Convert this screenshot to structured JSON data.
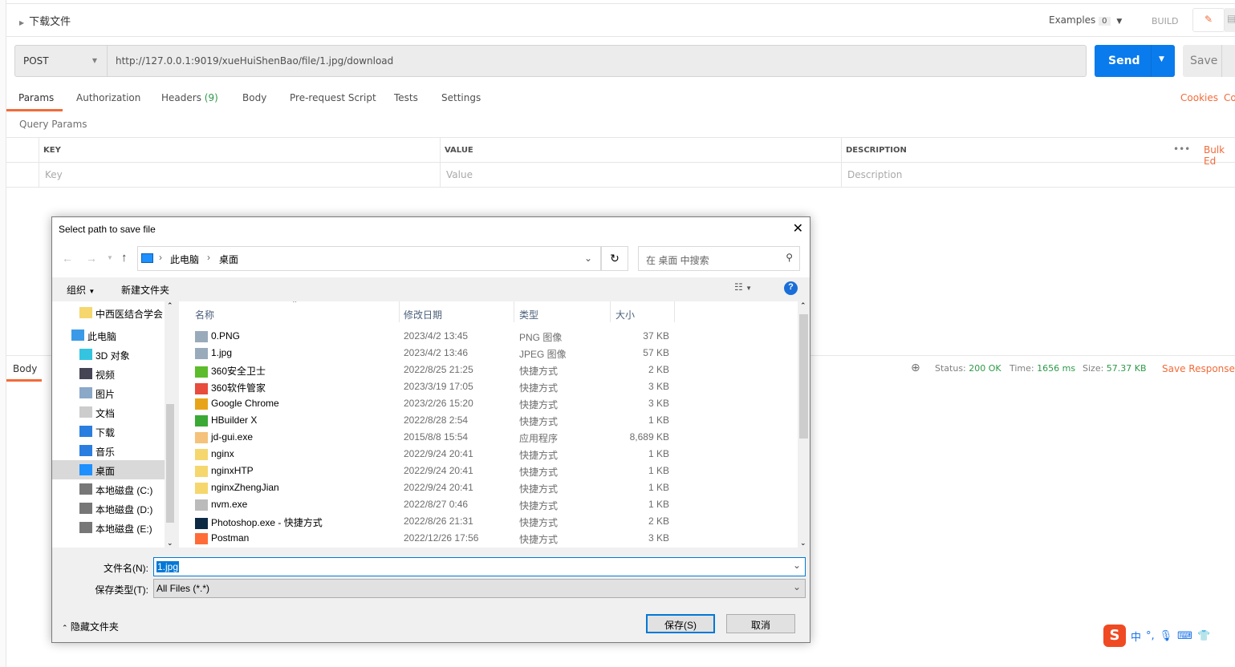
{
  "request": {
    "name": "下载文件",
    "examples_label": "Examples",
    "examples_count": "0",
    "build_label": "BUILD",
    "method": "POST",
    "url": "http://127.0.0.1:9019/xueHuiShenBao/file/1.jpg/download",
    "send_label": "Send",
    "save_label": "Save"
  },
  "tabs": [
    {
      "label": "Params",
      "active": true
    },
    {
      "label": "Authorization"
    },
    {
      "label": "Headers",
      "count": "(9)"
    },
    {
      "label": "Body"
    },
    {
      "label": "Pre-request Script"
    },
    {
      "label": "Tests"
    },
    {
      "label": "Settings"
    }
  ],
  "links": {
    "cookies": "Cookies",
    "code": "Co",
    "bulk_edit": "Bulk Ed"
  },
  "params": {
    "title": "Query Params",
    "headers": [
      "KEY",
      "VALUE",
      "DESCRIPTION"
    ],
    "placeholders": [
      "Key",
      "Value",
      "Description"
    ],
    "more": "•••"
  },
  "response": {
    "body_tab": "Body",
    "status_label": "Status:",
    "status": "200 OK",
    "time_label": "Time:",
    "time": "1656 ms",
    "size_label": "Size:",
    "size": "57.37 KB",
    "save_response": "Save Response"
  },
  "dialog": {
    "title": "Select path to save file",
    "breadcrumb": [
      "此电脑",
      "桌面"
    ],
    "search_placeholder": "在 桌面 中搜索",
    "organize": "组织",
    "new_folder": "新建文件夹",
    "nav": [
      {
        "label": "中西医结合学会",
        "icon": "folder-icon"
      },
      {
        "label": "此电脑",
        "icon": "computer-icon"
      },
      {
        "label": "3D 对象",
        "icon": "cube-icon"
      },
      {
        "label": "视频",
        "icon": "video-icon"
      },
      {
        "label": "图片",
        "icon": "picture-icon"
      },
      {
        "label": "文档",
        "icon": "document-icon"
      },
      {
        "label": "下载",
        "icon": "download-icon"
      },
      {
        "label": "音乐",
        "icon": "music-icon"
      },
      {
        "label": "桌面",
        "icon": "desktop-icon",
        "selected": true
      },
      {
        "label": "本地磁盘 (C:)",
        "icon": "drive-icon"
      },
      {
        "label": "本地磁盘 (D:)",
        "icon": "drive-icon"
      },
      {
        "label": "本地磁盘 (E:)",
        "icon": "drive-icon"
      }
    ],
    "columns": [
      "名称",
      "修改日期",
      "类型",
      "大小"
    ],
    "files": [
      {
        "name": "0.PNG",
        "date": "2023/4/2 13:45",
        "type": "PNG 图像",
        "size": "37 KB",
        "icon": "image-icon"
      },
      {
        "name": "1.jpg",
        "date": "2023/4/2 13:46",
        "type": "JPEG 图像",
        "size": "57 KB",
        "icon": "image-icon"
      },
      {
        "name": "360安全卫士",
        "date": "2022/8/25 21:25",
        "type": "快捷方式",
        "size": "2 KB",
        "icon": "360-icon"
      },
      {
        "name": "360软件管家",
        "date": "2023/3/19 17:05",
        "type": "快捷方式",
        "size": "3 KB",
        "icon": "360-manager-icon"
      },
      {
        "name": "Google Chrome",
        "date": "2023/2/26 15:20",
        "type": "快捷方式",
        "size": "3 KB",
        "icon": "chrome-icon"
      },
      {
        "name": "HBuilder X",
        "date": "2022/8/28 2:54",
        "type": "快捷方式",
        "size": "1 KB",
        "icon": "hbuilder-icon"
      },
      {
        "name": "jd-gui.exe",
        "date": "2015/8/8 15:54",
        "type": "应用程序",
        "size": "8,689 KB",
        "icon": "coffee-icon"
      },
      {
        "name": "nginx",
        "date": "2022/9/24 20:41",
        "type": "快捷方式",
        "size": "1 KB",
        "icon": "folder-shortcut-icon"
      },
      {
        "name": "nginxHTP",
        "date": "2022/9/24 20:41",
        "type": "快捷方式",
        "size": "1 KB",
        "icon": "folder-shortcut-icon"
      },
      {
        "name": "nginxZhengJian",
        "date": "2022/9/24 20:41",
        "type": "快捷方式",
        "size": "1 KB",
        "icon": "folder-shortcut-icon"
      },
      {
        "name": "nvm.exe",
        "date": "2022/8/27 0:46",
        "type": "快捷方式",
        "size": "1 KB",
        "icon": "exe-icon"
      },
      {
        "name": "Photoshop.exe - 快捷方式",
        "date": "2022/8/26 21:31",
        "type": "快捷方式",
        "size": "2 KB",
        "icon": "photoshop-icon"
      },
      {
        "name": "Postman",
        "date": "2022/12/26 17:56",
        "type": "快捷方式",
        "size": "3 KB",
        "icon": "postman-icon"
      }
    ],
    "filename_label": "文件名(N):",
    "filename": "1.jpg",
    "filetype_label": "保存类型(T):",
    "filetype": "All Files (*.*)",
    "hide_folders": "隐藏文件夹",
    "save_button": "保存(S)",
    "cancel_button": "取消"
  },
  "ime": {
    "mode": "中",
    "punct": "°,"
  },
  "colors": {
    "accent": "#f26b3a",
    "send": "#097bed",
    "success": "#2d9a48",
    "selection": "#0078d7"
  }
}
